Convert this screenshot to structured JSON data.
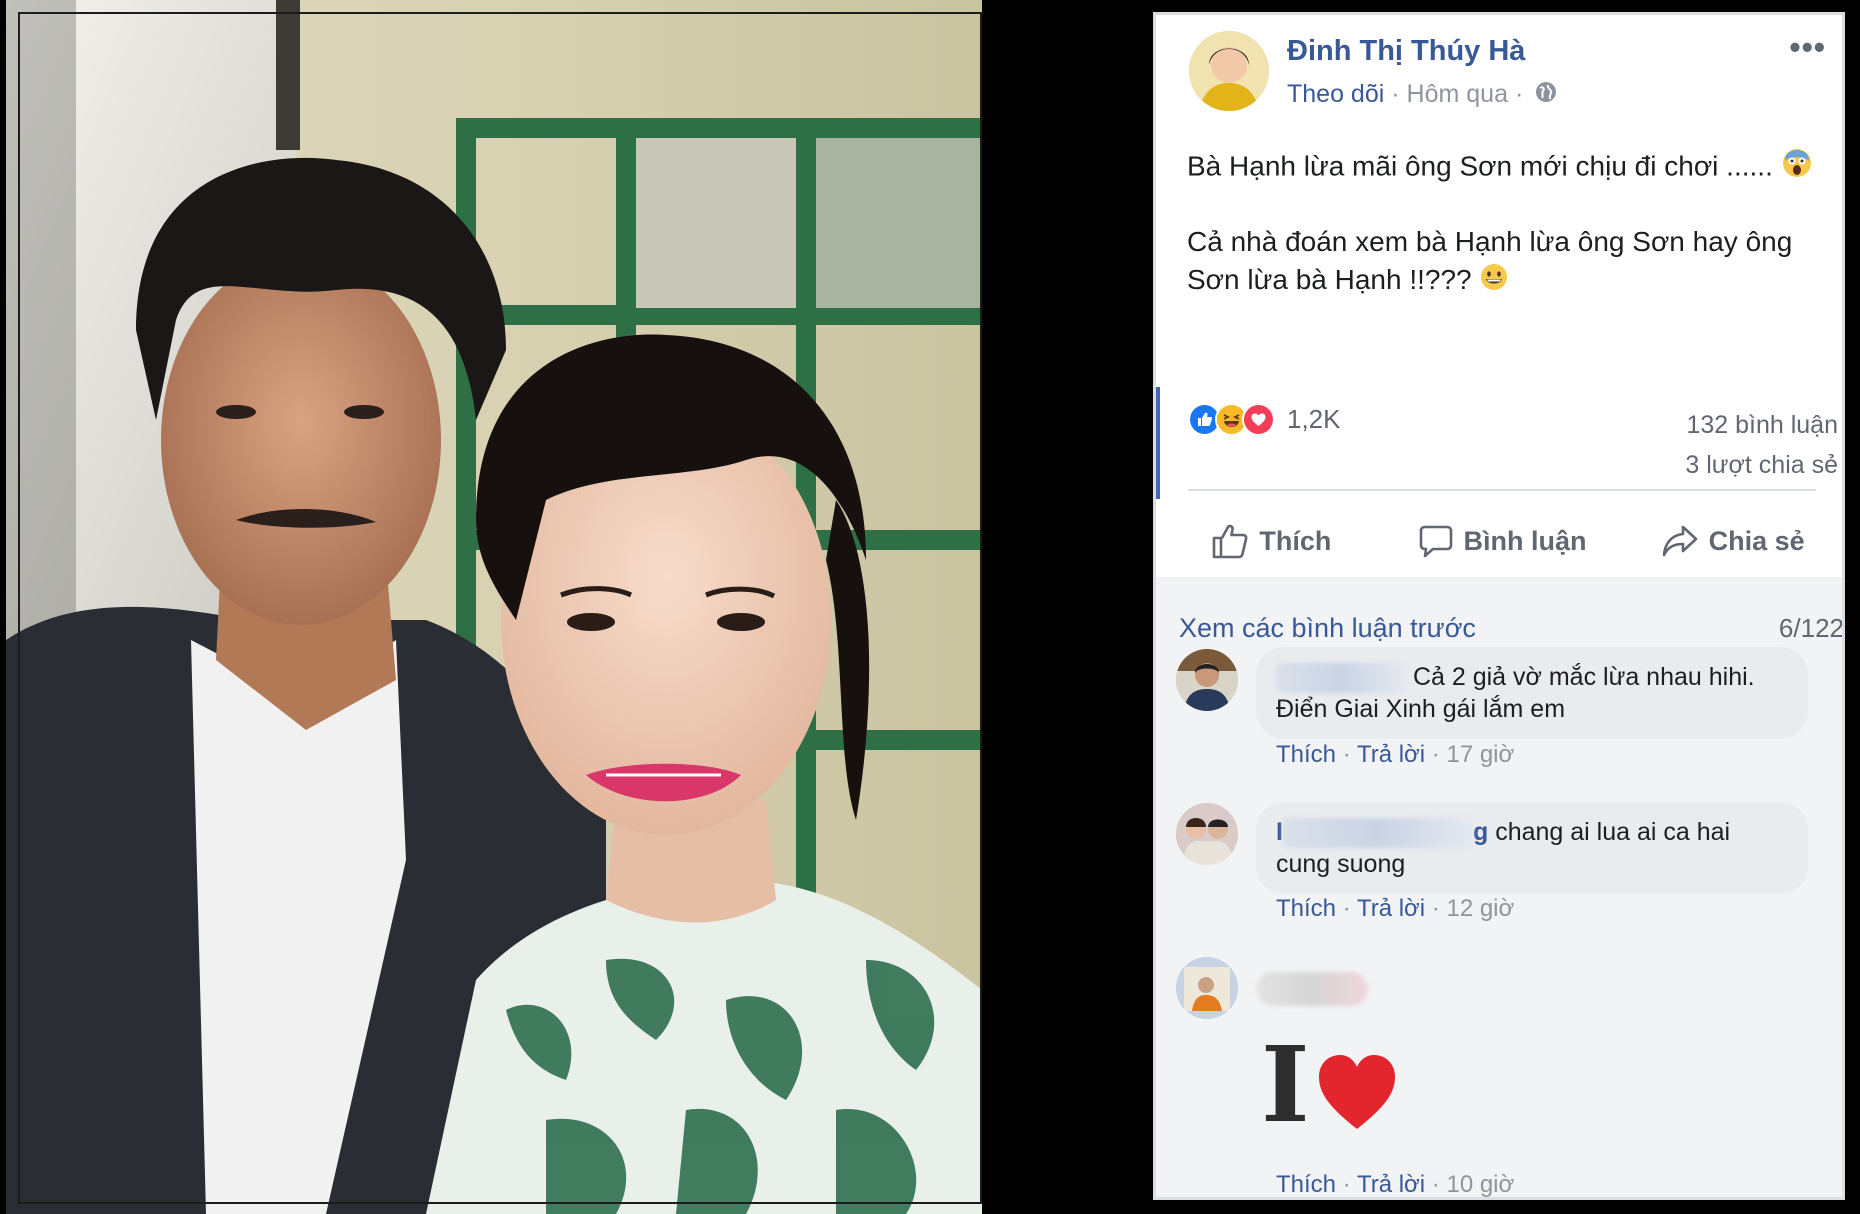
{
  "post": {
    "author": "Đinh Thị Thúy Hà",
    "follow": "Theo dõi",
    "sep1": "·",
    "time": "Hôm qua",
    "sep2": "·",
    "more": "•••",
    "text_line1": "Bà Hạnh lừa mãi ông Sơn mới chịu đi chơi ......",
    "text_line2": "Cả nhà đoán xem bà Hạnh lừa ông Sơn hay ông Sơn lừa bà Hạnh !!???",
    "reaction_count": "1,2K",
    "comments_count": "132 bình luận",
    "shares_count": "3 lượt chia sẻ"
  },
  "actions": {
    "like": "Thích",
    "comment": "Bình luận",
    "share": "Chia sẻ"
  },
  "comments": {
    "view_previous": "Xem các bình luận trước",
    "count": "6/122",
    "items": [
      {
        "text_line1": "Cả 2 giả vờ mắc lừa nhau hihi.",
        "text_line2": "Điển Giai Xinh gái lắm em",
        "like": "Thích",
        "sep1": "·",
        "reply": "Trả lời",
        "sep2": "·",
        "time": "17 giờ"
      },
      {
        "name_start": "I",
        "name_end": "g",
        "text_line1": "chang ai lua ai ca hai",
        "text_line2": "cung suong",
        "like": "Thích",
        "sep1": "·",
        "reply": "Trả lời",
        "sep2": "·",
        "time": "12 giờ"
      },
      {
        "sticker_letter": "I",
        "like": "Thích",
        "sep1": "·",
        "reply": "Trả lời",
        "sep2": "·",
        "time": "10 giờ"
      }
    ]
  },
  "colors": {
    "link": "#385898",
    "meta": "#90949c",
    "like_blue": "#1877f2",
    "love_red": "#f33e58",
    "haha_yellow": "#f7b928"
  }
}
